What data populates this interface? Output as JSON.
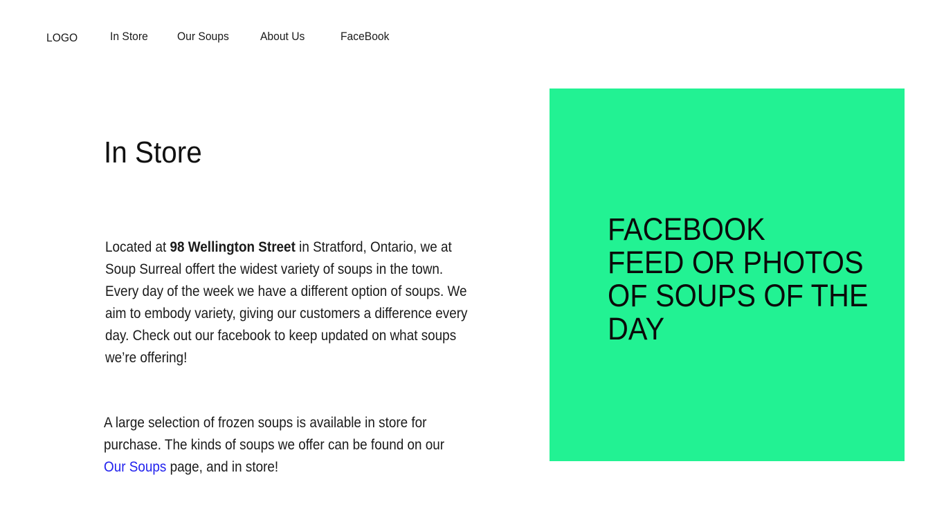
{
  "nav": {
    "logo": "LOGO",
    "items": [
      {
        "label": "In Store"
      },
      {
        "label": "Our Soups"
      },
      {
        "label": "About Us"
      },
      {
        "label": "FaceBook"
      }
    ]
  },
  "main": {
    "title": "In Store",
    "paragraph1": {
      "before": "Located at ",
      "bold": "98 Wellington Street",
      "after": " in Stratford, Ontario, we at Soup Surreal offert the widest variety of soups in the town. Every day of the week we have a different option of soups. We aim to embody variety, giving our customers a difference every day. Check out our facebook to keep updated on what soups we’re offering!"
    },
    "paragraph2": {
      "before": "A large selection of frozen soups is available in store for purchase. The kinds of soups we offer can be found on our ",
      "link": "Our Soups",
      "after": " page, and in store!"
    }
  },
  "sidebar": {
    "placeholder_lines": [
      "FACEBOOK",
      "FEED OR PHOTOS",
      "OF SOUPS OF THE",
      "DAY"
    ],
    "background_color": "#22f293"
  },
  "colors": {
    "accent_link": "#2222ee",
    "text": "#111111"
  }
}
